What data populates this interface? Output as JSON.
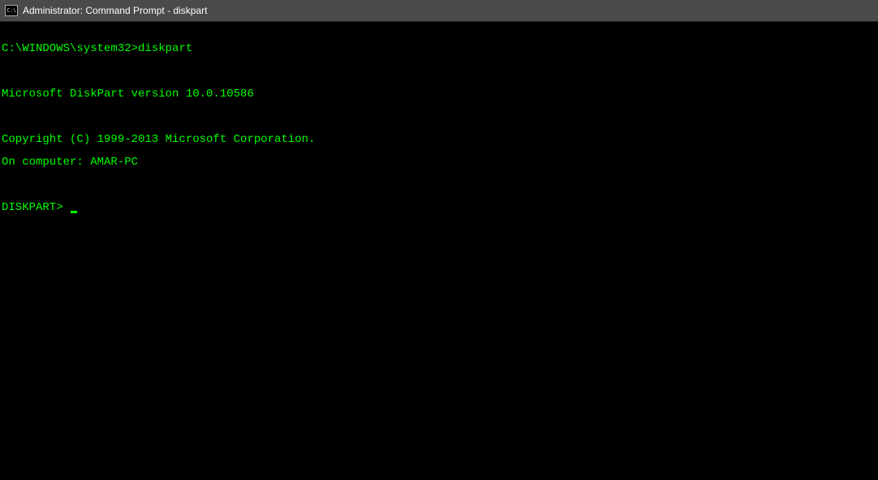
{
  "titlebar": {
    "icon_text": "C:\\",
    "title": "Administrator: Command Prompt - diskpart"
  },
  "terminal": {
    "prompt_path": "C:\\WINDOWS\\system32>",
    "command": "diskpart",
    "blank1": "",
    "version_line": "Microsoft DiskPart version 10.0.10586",
    "blank2": "",
    "copyright_line": "Copyright (C) 1999-2013 Microsoft Corporation.",
    "computer_line": "On computer: AMAR-PC",
    "blank3": "",
    "diskpart_prompt": "DISKPART> "
  }
}
